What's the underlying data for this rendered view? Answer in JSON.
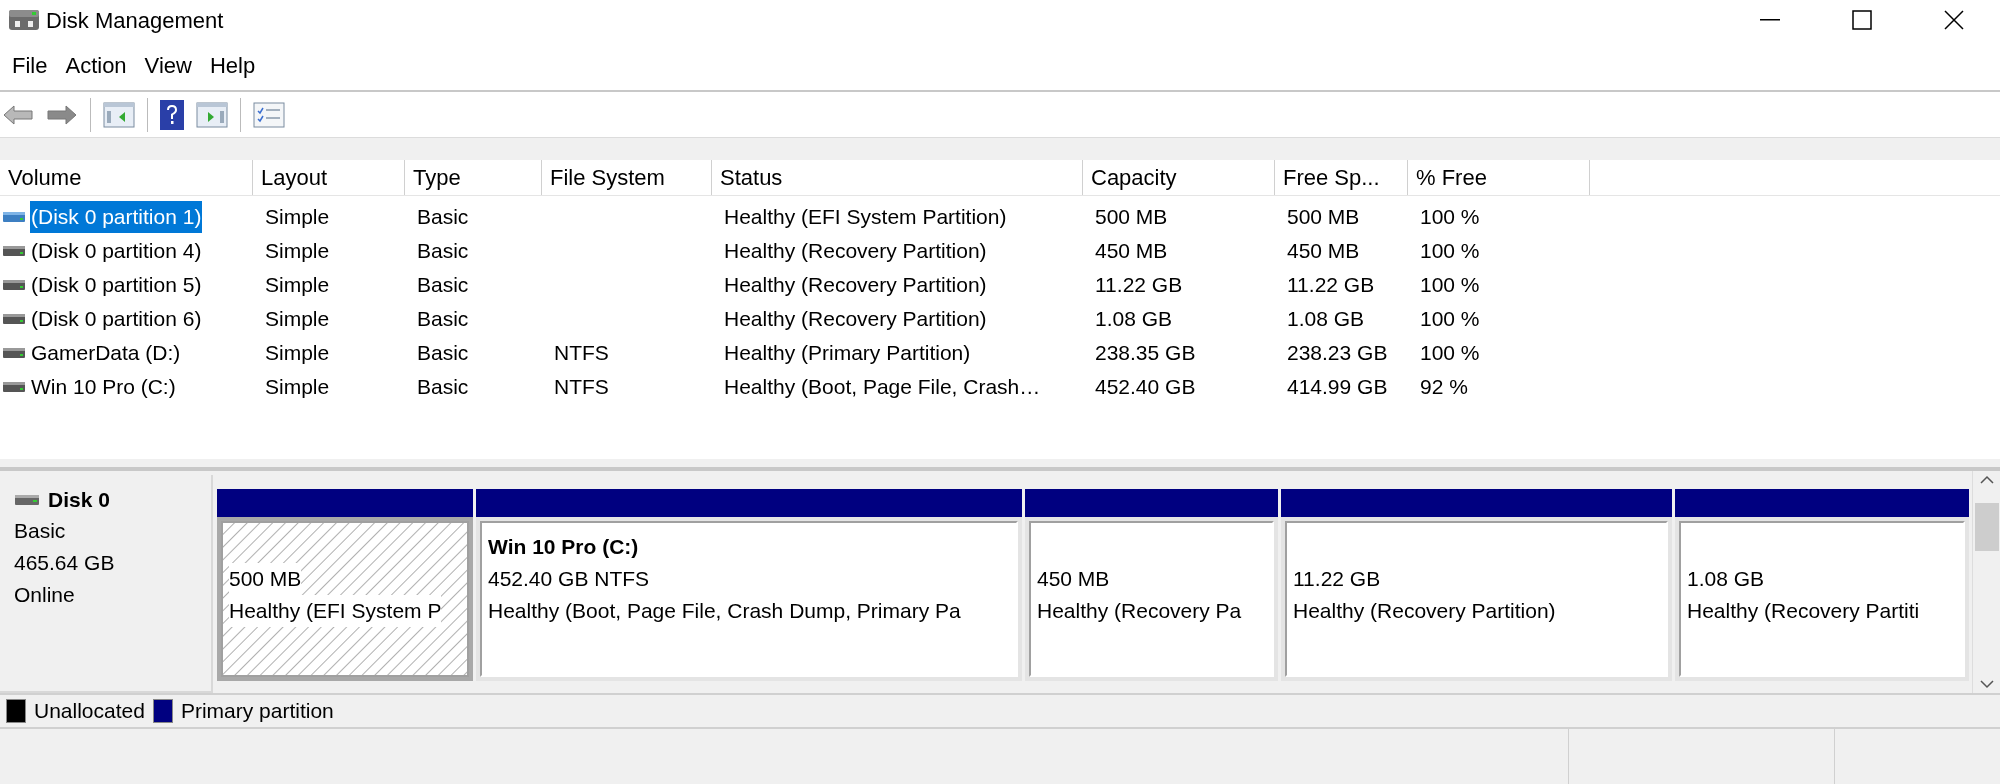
{
  "window": {
    "title": "Disk Management"
  },
  "menu": [
    "File",
    "Action",
    "View",
    "Help"
  ],
  "toolbar": [
    {
      "kind": "back",
      "disabled": true
    },
    {
      "kind": "forward",
      "disabled": false
    },
    {
      "kind": "tree"
    },
    {
      "kind": "help"
    },
    {
      "kind": "pane"
    },
    {
      "kind": "properties"
    }
  ],
  "table": {
    "columns": [
      "Volume",
      "Layout",
      "Type",
      "File System",
      "Status",
      "Capacity",
      "Free Sp...",
      "% Free"
    ],
    "rows": [
      {
        "selected": true,
        "cells": [
          "(Disk 0 partition 1)",
          "Simple",
          "Basic",
          "",
          "Healthy (EFI System Partition)",
          "500 MB",
          "500 MB",
          "100 %"
        ]
      },
      {
        "selected": false,
        "cells": [
          "(Disk 0 partition 4)",
          "Simple",
          "Basic",
          "",
          "Healthy (Recovery Partition)",
          "450 MB",
          "450 MB",
          "100 %"
        ]
      },
      {
        "selected": false,
        "cells": [
          "(Disk 0 partition 5)",
          "Simple",
          "Basic",
          "",
          "Healthy (Recovery Partition)",
          "11.22 GB",
          "11.22 GB",
          "100 %"
        ]
      },
      {
        "selected": false,
        "cells": [
          "(Disk 0 partition 6)",
          "Simple",
          "Basic",
          "",
          "Healthy (Recovery Partition)",
          "1.08 GB",
          "1.08 GB",
          "100 %"
        ]
      },
      {
        "selected": false,
        "cells": [
          "GamerData (D:)",
          "Simple",
          "Basic",
          "NTFS",
          "Healthy (Primary Partition)",
          "238.35 GB",
          "238.23 GB",
          "100 %"
        ]
      },
      {
        "selected": false,
        "cells": [
          "Win 10 Pro (C:)",
          "Simple",
          "Basic",
          "NTFS",
          "Healthy (Boot, Page File, Crash…",
          "452.40 GB",
          "414.99 GB",
          "92 %"
        ]
      }
    ]
  },
  "disk": {
    "name": "Disk 0",
    "type": "Basic",
    "size": "465.64 GB",
    "state": "Online",
    "partitions": [
      {
        "selected": true,
        "color": "#000080",
        "size": "500 MB",
        "status": "Healthy (EFI System P"
      },
      {
        "selected": false,
        "color": "#000080",
        "label": "Win 10 Pro  (C:)",
        "size": "452.40 GB NTFS",
        "status": "Healthy (Boot, Page File, Crash Dump, Primary Pa"
      },
      {
        "selected": false,
        "color": "#000080",
        "size": "450 MB",
        "status": "Healthy (Recovery Pa"
      },
      {
        "selected": false,
        "color": "#000080",
        "size": "11.22 GB",
        "status": "Healthy (Recovery Partition)"
      },
      {
        "selected": false,
        "color": "#000080",
        "size": "1.08 GB",
        "status": "Healthy (Recovery Partiti"
      }
    ]
  },
  "legend": [
    {
      "label": "Unallocated",
      "color": "#000000"
    },
    {
      "label": "Primary partition",
      "color": "#000080"
    }
  ]
}
